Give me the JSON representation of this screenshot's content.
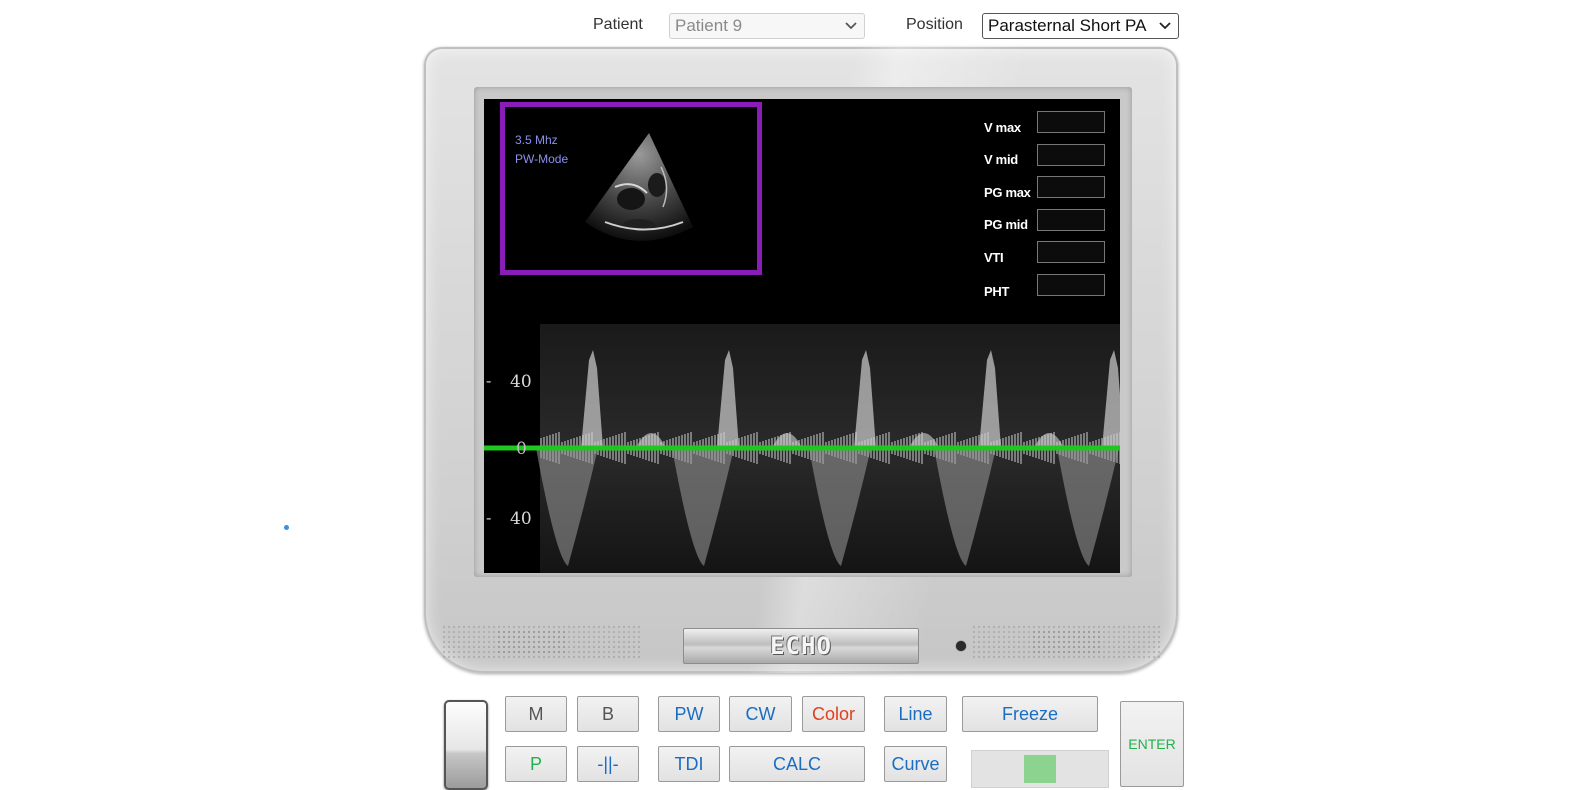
{
  "selectors": {
    "patient_label": "Patient",
    "patient_value": "Patient 9",
    "position_label": "Position",
    "position_value": "Parasternal Short PA"
  },
  "preview": {
    "frequency": "3.5 Mhz",
    "mode": "PW-Mode"
  },
  "measurements": [
    {
      "label": "V max",
      "value": ""
    },
    {
      "label": "V mid",
      "value": ""
    },
    {
      "label": "PG max",
      "value": ""
    },
    {
      "label": "PG mid",
      "value": ""
    },
    {
      "label": "VTI",
      "value": ""
    },
    {
      "label": "PHT",
      "value": ""
    }
  ],
  "doppler_scale": {
    "top": "40",
    "zero": "0",
    "bottom": "40",
    "baseline_color": "#1ec81e"
  },
  "brand": "ECHO",
  "controls": {
    "m": "M",
    "b": "B",
    "pw": "PW",
    "cw": "CW",
    "color": "Color",
    "line": "Line",
    "freeze": "Freeze",
    "enter": "ENTER",
    "p": "P",
    "split": "-||-",
    "tdi": "TDI",
    "calc": "CALC",
    "curve": "Curve"
  },
  "slider": {
    "level": 0.5
  },
  "colors": {
    "preview_frame": "#8a1cb8",
    "accent_blue": "#1a6dc2",
    "accent_red": "#e0401e",
    "accent_green": "#22b14c"
  },
  "icons": [
    "chevron-down-icon",
    "speaker-grill-icon",
    "power-led-icon",
    "probe-toggle-icon"
  ]
}
